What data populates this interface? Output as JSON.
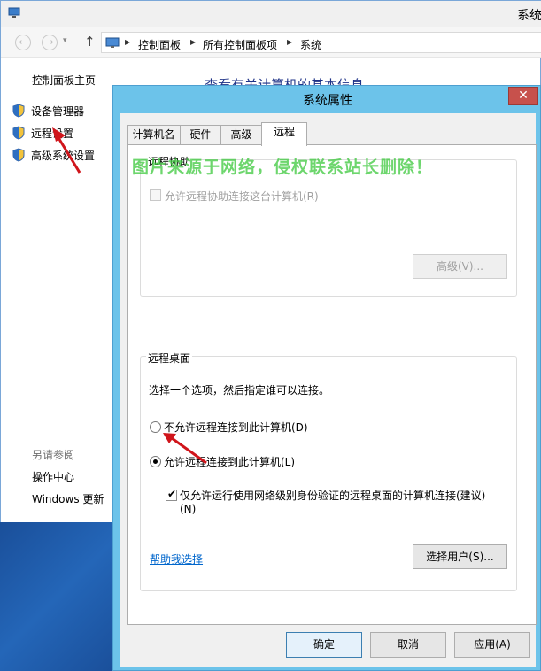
{
  "colors": {
    "dialog_frame": "#6cc3ea",
    "close_button": "#c7514c",
    "link": "#0066cc",
    "heading": "#1e3287",
    "watermark": "#3cc83c",
    "annotation_arrow": "#d0151b"
  },
  "window": {
    "title": "系统"
  },
  "nav": {
    "back_icon": "back-arrow-icon",
    "forward_icon": "forward-arrow-icon",
    "up_icon": "up-arrow-icon",
    "breadcrumb": [
      "控制面板",
      "所有控制面板项",
      "系统"
    ]
  },
  "sidebar": {
    "home": "控制面板主页",
    "items": [
      {
        "label": "设备管理器",
        "icon": "shield-icon"
      },
      {
        "label": "远程设置",
        "icon": "shield-icon"
      },
      {
        "label": "高级系统设置",
        "icon": "shield-icon"
      }
    ],
    "see_also_title": "另请参阅",
    "see_also_links": [
      "操作中心",
      "Windows 更新"
    ]
  },
  "main": {
    "heading": "查看有关计算机的基本信息"
  },
  "dialog": {
    "title": "系统属性",
    "close_label": "✕",
    "tabs": [
      {
        "label": "计算机名",
        "active": false
      },
      {
        "label": "硬件",
        "active": false
      },
      {
        "label": "高级",
        "active": false
      },
      {
        "label": "远程",
        "active": true
      }
    ],
    "remote_assistance": {
      "title": "远程协助",
      "allow_label": "允许远程协助连接这台计算机(R)",
      "allow_checked": false,
      "advanced_button": "高级(V)..."
    },
    "remote_desktop": {
      "title": "远程桌面",
      "instruction": "选择一个选项，然后指定谁可以连接。",
      "option_deny": "不允许远程连接到此计算机(D)",
      "option_allow": "允许远程连接到此计算机(L)",
      "selected": "allow",
      "nla_label_line1": "仅允许运行使用网络级别身份验证的远程桌面的计算机连接(建议)",
      "nla_label_line2": "(N)",
      "nla_checked": true,
      "help_link": "帮助我选择",
      "select_users_button": "选择用户(S)..."
    },
    "buttons": {
      "ok": "确定",
      "cancel": "取消",
      "apply": "应用(A)"
    }
  },
  "watermark": "图片来源于网络，侵权联系站长删除！"
}
